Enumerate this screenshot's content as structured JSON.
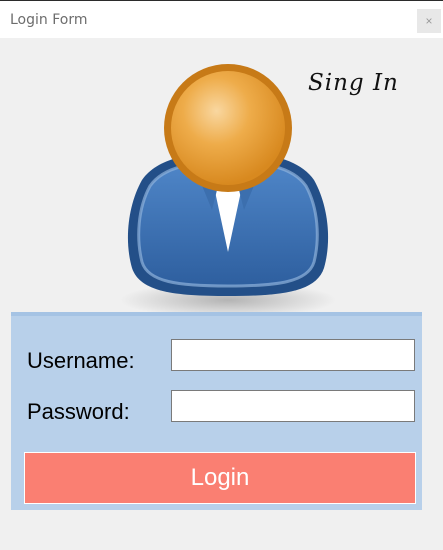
{
  "window": {
    "title": "Login Form",
    "close_glyph": "×"
  },
  "header": {
    "signin_text": "Sing In",
    "avatar_icon": "user-avatar-icon"
  },
  "form": {
    "username_label": "Username:",
    "username_value": "",
    "password_label": "Password:",
    "password_value": "",
    "login_label": "Login"
  },
  "colors": {
    "panel_bg": "#b8d0ea",
    "login_button_bg": "#fa7f72",
    "window_bg": "#f0f0f0",
    "avatar_body": "#3a6fb5",
    "avatar_head": "#e7a03a"
  }
}
